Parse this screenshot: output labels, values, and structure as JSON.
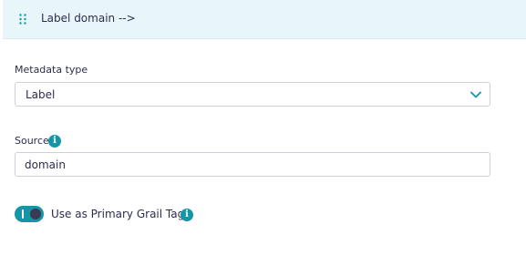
{
  "header": {
    "title": "Label domain -->",
    "drag_icon": "drag-handle-icon"
  },
  "metadata_type": {
    "label": "Metadata type",
    "selected_value": "Label",
    "icon": "chevron-down-icon"
  },
  "source": {
    "label": "Source",
    "value": "domain",
    "info_icon": "info-icon"
  },
  "primary_grail_tag": {
    "label": "Use as Primary Grail Tag",
    "enabled": true,
    "info_icon": "info-icon"
  },
  "colors": {
    "accent": "#1496a6",
    "header_bg": "#e8f6f9",
    "text": "#2c2d4d",
    "border": "#cfd1d9"
  }
}
